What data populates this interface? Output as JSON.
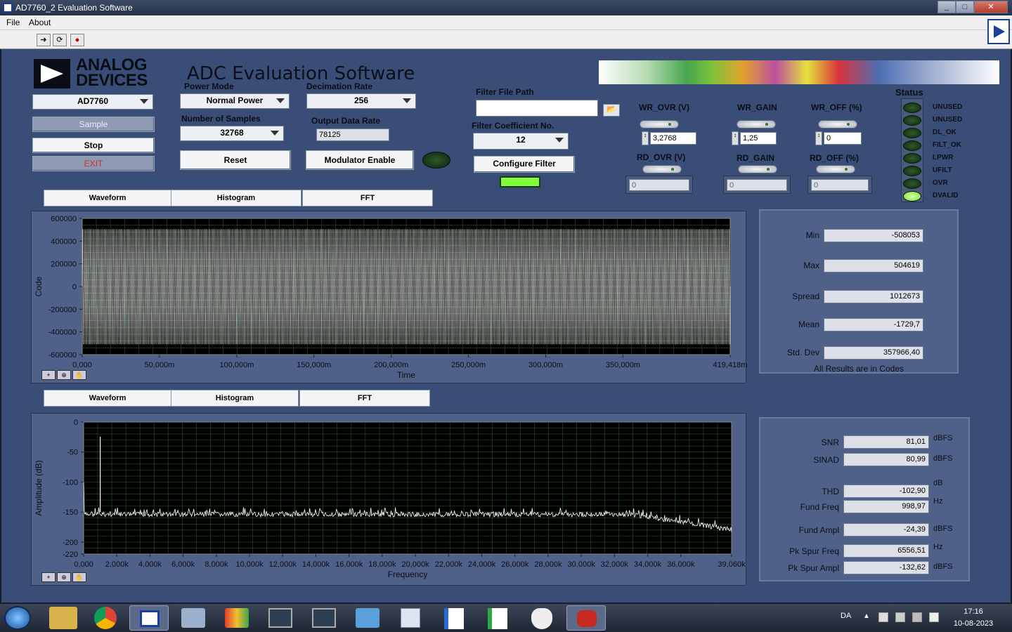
{
  "window": {
    "title": "AD7760_2 Evaluation Software",
    "controls": [
      "_",
      "□",
      "✕"
    ]
  },
  "menu": {
    "items": [
      "File",
      "About"
    ]
  },
  "app": {
    "brand_line1": "ANALOG",
    "brand_line2": "DEVICES",
    "title": "ADC Evaluation Software",
    "device_select": "AD7760",
    "buttons": {
      "sample": "Sample",
      "stop": "Stop",
      "exit": "EXIT",
      "reset": "Reset",
      "modulator": "Modulator Enable",
      "configure": "Configure Filter"
    },
    "power_mode": {
      "label": "Power Mode",
      "value": "Normal Power"
    },
    "samples": {
      "label": "Number of Samples",
      "value": "32768"
    },
    "decimation": {
      "label": "Decimation Rate",
      "value": "256"
    },
    "output_rate": {
      "label": "Output Data Rate",
      "value": "78125"
    },
    "filter_path": {
      "label": "Filter File Path",
      "value": ""
    },
    "filter_coeff": {
      "label": "Filter Coefficient No.",
      "value": "12"
    },
    "wr_ovr": {
      "label": "WR_OVR (V)",
      "value": "3,2768"
    },
    "wr_gain": {
      "label": "WR_GAIN",
      "value": "1,25"
    },
    "wr_off": {
      "label": "WR_OFF (%)",
      "value": "0"
    },
    "rd_ovr": {
      "label": "RD_OVR (V)",
      "value": "0"
    },
    "rd_gain": {
      "label": "RD_GAIN",
      "value": "0"
    },
    "rd_off": {
      "label": "RD_OFF (%)",
      "value": "0"
    },
    "status": {
      "title": "Status",
      "leds": [
        {
          "name": "UNUSED",
          "on": false
        },
        {
          "name": "UNUSED",
          "on": false
        },
        {
          "name": "DL_OK",
          "on": false
        },
        {
          "name": "FILT_OK",
          "on": false
        },
        {
          "name": "LPWR",
          "on": false
        },
        {
          "name": "UFILT",
          "on": false
        },
        {
          "name": "OVR",
          "on": false
        },
        {
          "name": "DVALID",
          "on": true
        }
      ]
    }
  },
  "tabs_top": [
    "Waveform",
    "Histogram",
    "FFT"
  ],
  "tabs_bottom": [
    "Waveform",
    "Histogram",
    "FFT"
  ],
  "chart_data": [
    {
      "type": "line",
      "xlabel": "Time",
      "ylabel": "Code",
      "ylim": [
        -600000,
        600000
      ],
      "xlim": [
        0,
        419.418
      ],
      "x_tick_labels": [
        "0,000",
        "50,000m",
        "100,000m",
        "150,000m",
        "200,000m",
        "250,000m",
        "300,000m",
        "350,000m",
        "419,418m"
      ],
      "y_tick_labels": [
        "600000",
        "400000",
        "200000",
        "0",
        "-200000",
        "-400000",
        "-600000"
      ],
      "series": [
        {
          "description": "sine waveform ~1kHz, amplitude ±508000 codes",
          "min": -508053,
          "max": 504619
        }
      ]
    },
    {
      "type": "line",
      "xlabel": "Frequency",
      "ylabel": "Amplitude (dB)",
      "ylim": [
        -220,
        0
      ],
      "xlim": [
        0,
        39060
      ],
      "x_tick_labels": [
        "0,000",
        "2,000k",
        "4,000k",
        "6,000k",
        "8,000k",
        "10,000k",
        "12,000k",
        "14,000k",
        "16,000k",
        "18,000k",
        "20,000k",
        "22,000k",
        "24,000k",
        "26,000k",
        "28,000k",
        "30,000k",
        "32,000k",
        "34,000k",
        "36,000k",
        "39,060k"
      ],
      "y_tick_labels": [
        "0",
        "-50",
        "-100",
        "-150",
        "-200",
        "-220"
      ],
      "series": [
        {
          "description": "FFT with fundamental at 998,97 Hz (-24,39 dBFS), noise floor ~-150 dB rolling off after 34kHz"
        }
      ]
    }
  ],
  "waveform_stats": {
    "note": "All Results are in Codes",
    "rows": [
      {
        "label": "Min",
        "value": "-508053"
      },
      {
        "label": "Max",
        "value": "504619"
      },
      {
        "label": "Spread",
        "value": "1012673"
      },
      {
        "label": "Mean",
        "value": "-1729,7"
      },
      {
        "label": "Std. Dev",
        "value": "357966,40"
      }
    ]
  },
  "fft_stats": {
    "rows": [
      {
        "label": "SNR",
        "value": "81,01",
        "unit": "dBFS"
      },
      {
        "label": "SINAD",
        "value": "80,99",
        "unit": "dBFS"
      },
      {
        "label": "THD",
        "value": "-102,90",
        "unit": "dB"
      },
      {
        "label": "Fund Freq",
        "value": "998,97",
        "unit": "Hz"
      },
      {
        "label": "Fund Ampl",
        "value": "-24,39",
        "unit": "dBFS"
      },
      {
        "label": "Pk Spur Freq",
        "value": "6556,51",
        "unit": "Hz"
      },
      {
        "label": "Pk Spur Ampl",
        "value": "-132,62",
        "unit": "dBFS"
      }
    ]
  },
  "taskbar": {
    "lang": "DA",
    "time": "17:16",
    "date": "10-08-2023"
  }
}
